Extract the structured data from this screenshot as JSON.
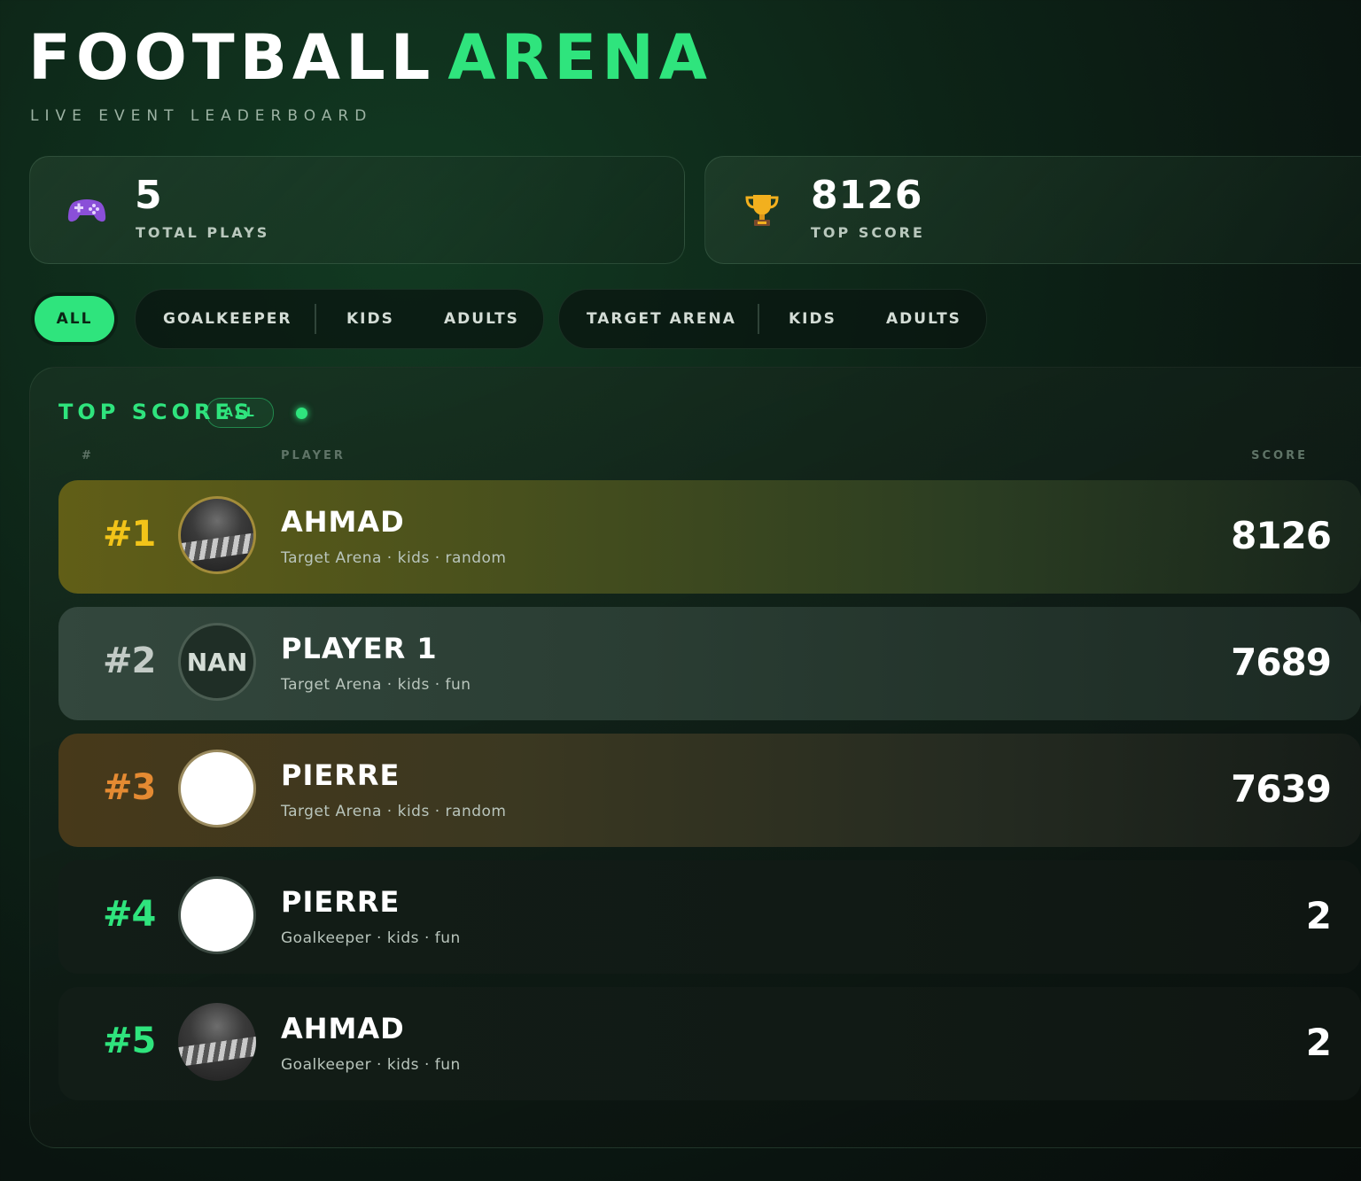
{
  "header": {
    "title_part1": "FOOTBALL",
    "title_part2": "ARENA",
    "subtitle": "LIVE EVENT LEADERBOARD",
    "accent_color": "#2fe47d"
  },
  "stats": [
    {
      "icon": "gamepad-icon",
      "value": "5",
      "label": "TOTAL PLAYS"
    },
    {
      "icon": "trophy-icon",
      "value": "8126",
      "label": "TOP SCORE"
    }
  ],
  "filters": {
    "all": "ALL",
    "goalkeeper": {
      "label": "GOALKEEPER",
      "kids": "KIDS",
      "adults": "ADULTS"
    },
    "target_arena": {
      "label": "TARGET ARENA",
      "kids": "KIDS",
      "adults": "ADULTS"
    }
  },
  "leaderboard": {
    "title": "TOP SCORES",
    "badge": "ALL",
    "columns": {
      "rank": "#",
      "player": "PLAYER",
      "score": "SCORE"
    },
    "rows": [
      {
        "rank": "#1",
        "name": "AHMAD",
        "meta": "Target Arena · kids · random",
        "score": "8126",
        "rank_color": "#f2c419",
        "avatar": "photo"
      },
      {
        "rank": "#2",
        "name": "PLAYER 1",
        "meta": "Target Arena · kids · fun",
        "score": "7689",
        "rank_color": "#c3cbc6",
        "avatar": "NAN"
      },
      {
        "rank": "#3",
        "name": "PIERRE",
        "meta": "Target Arena · kids · random",
        "score": "7639",
        "rank_color": "#e48a32",
        "avatar": "blank"
      },
      {
        "rank": "#4",
        "name": "PIERRE",
        "meta": "Goalkeeper · kids · fun",
        "score": "2",
        "rank_color": "#2fe47d",
        "avatar": "blank"
      },
      {
        "rank": "#5",
        "name": "AHMAD",
        "meta": "Goalkeeper · kids · fun",
        "score": "2",
        "rank_color": "#2fe47d",
        "avatar": "photo"
      }
    ]
  }
}
